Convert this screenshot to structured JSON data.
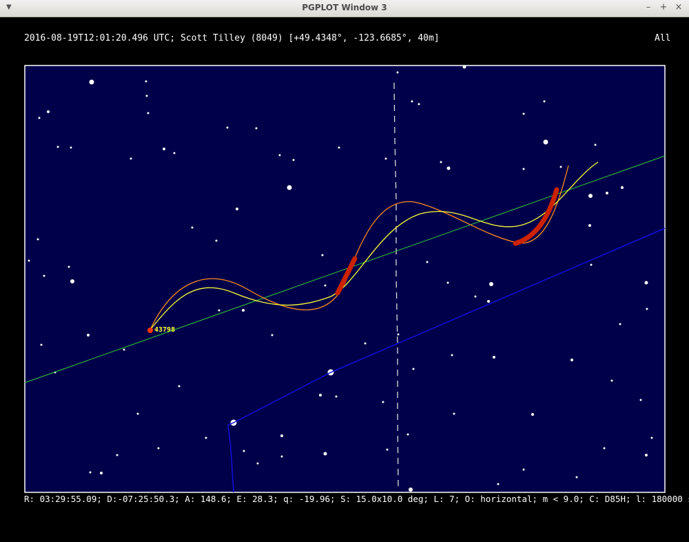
{
  "window": {
    "title": "PGPLOT Window 3",
    "controls": [
      "–",
      "+",
      "×"
    ]
  },
  "header": {
    "info": "2016-08-19T12:01:20.496 UTC; Scott Tilley (8049) [+49.4348°, -123.6685°, 40m]",
    "filter": "All"
  },
  "satellite": {
    "label": "43798"
  },
  "status_line": "R: 03:29:55.09; D:-07:25:50.3; A: 148.6; E: 28.3; q: -19.96; S: 15.0x10.0 deg; L: 7; O: horizontal; m < 9.0; C: D85H; l: 180000 s",
  "colors": {
    "sky": "#00004a",
    "frame": "#ffffff",
    "green_line": "#33cc33",
    "blue_line": "#1010dd",
    "orange_track": "#ff8c1a",
    "yellow_track": "#ffff33",
    "red_marks": "#dd2200"
  }
}
